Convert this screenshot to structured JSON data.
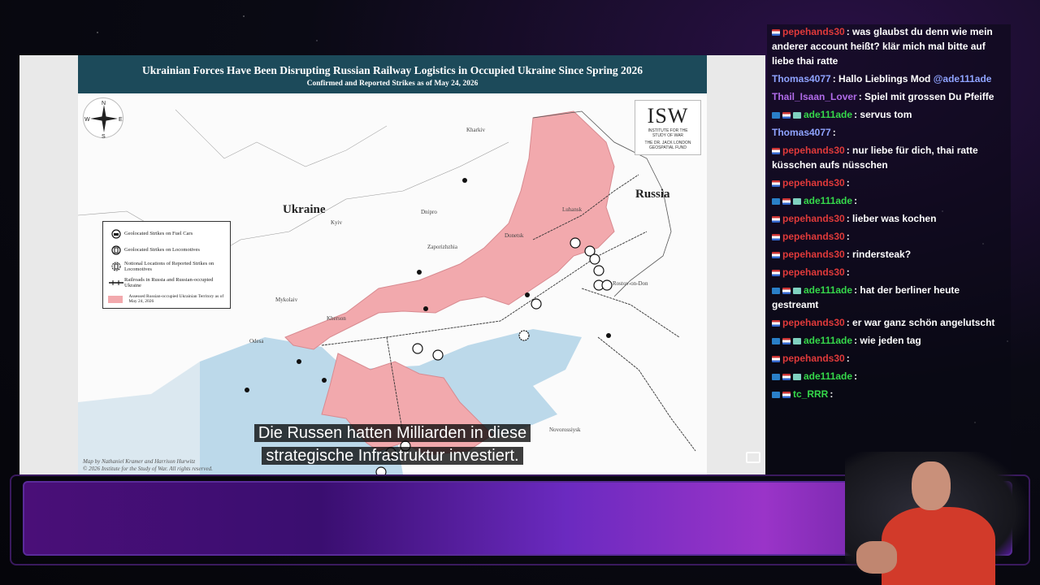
{
  "map": {
    "title": "Ukrainian Forces Have Been Disrupting Russian Railway Logistics in Occupied Ukraine Since Spring 2026",
    "subtitle": "Confirmed and Reported Strikes as of May 24, 2026",
    "compass": {
      "n": "N",
      "s": "S",
      "e": "E",
      "w": "W"
    },
    "logo": {
      "letters": "ISW",
      "org_line1": "INSTITUTE FOR THE",
      "org_line2": "STUDY OF WAR",
      "fund_line1": "THE DR. JACK LONDON",
      "fund_line2": "GEOSPATIAL FUND"
    },
    "countries": {
      "ukraine": "Ukraine",
      "russia": "Russia"
    },
    "cities": {
      "kharkiv": "Kharkiv",
      "kyiv": "Kyiv",
      "dnipro": "Dnipro",
      "zaporizhzhia": "Zaporizhzhia",
      "donetsk": "Donetsk",
      "luhansk": "Luhansk",
      "rostov": "Rostov-on-Don",
      "mykolaiv": "Mykolaiv",
      "kherson": "Kherson",
      "odesa": "Odesa",
      "novorossiysk": "Novorossiysk"
    },
    "legend": {
      "fuel_cars": "Geolocated Strikes on Fuel Cars",
      "locomotives": "Geolocated Strikes on Locomotives",
      "notional": "Notional Locations of Reported Strikes on Locomotives",
      "railroads": "Railroads in Russia and Russian-occupied Ukraine",
      "occupied": "Assessed Russian-occupied Ukrainian Territory as of May 24, 2026"
    },
    "credits": {
      "line1": "Map by Nathaniel Kramer and Harrison Hurwitz",
      "line2": "© 2026 Institute for the Study of War. All rights reserved."
    },
    "colors": {
      "occupied": "#f2a9ad",
      "sea": "#bcd9ea",
      "title_bar": "#1c4a5a"
    }
  },
  "caption": {
    "line1": "Die Russen hatten Milliarden in diese",
    "line2": "strategische Infrastruktur investiert."
  },
  "chat": [
    {
      "name": "pepehands30",
      "color": "#e03a3a",
      "badges": [
        "flag"
      ],
      "message": ": was glaubst du denn wie mein anderer account heißt? klär mich mal bitte auf liebe thai ratte"
    },
    {
      "name": "Thomas4077",
      "color": "#8fa3ff",
      "badges": [],
      "message": ": Hallo Lieblings Mod ",
      "mention": "@ade111ade"
    },
    {
      "name": "Thail_Isaan_Lover",
      "color": "#b06be8",
      "badges": [],
      "message": ": Spiel mit grossen Du Pfeiffe"
    },
    {
      "name": "ade111ade",
      "color": "#35d84a",
      "badges": [
        "vip",
        "flag",
        "sub"
      ],
      "message": ": servus tom"
    },
    {
      "name": "Thomas4077",
      "color": "#8fa3ff",
      "badges": [],
      "message": ":"
    },
    {
      "name": "pepehands30",
      "color": "#e03a3a",
      "badges": [
        "flag"
      ],
      "message": ": nur liebe für dich, thai ratte küsschen aufs nüsschen"
    },
    {
      "name": "pepehands30",
      "color": "#e03a3a",
      "badges": [
        "flag"
      ],
      "message": ":"
    },
    {
      "name": "ade111ade",
      "color": "#35d84a",
      "badges": [
        "vip",
        "flag",
        "sub"
      ],
      "message": ":"
    },
    {
      "name": "pepehands30",
      "color": "#e03a3a",
      "badges": [
        "flag"
      ],
      "message": ": lieber was kochen"
    },
    {
      "name": "pepehands30",
      "color": "#e03a3a",
      "badges": [
        "flag"
      ],
      "message": ":"
    },
    {
      "name": "pepehands30",
      "color": "#e03a3a",
      "badges": [
        "flag"
      ],
      "message": ": rindersteak?"
    },
    {
      "name": "pepehands30",
      "color": "#e03a3a",
      "badges": [
        "flag"
      ],
      "message": ":"
    },
    {
      "name": "ade111ade",
      "color": "#35d84a",
      "badges": [
        "vip",
        "flag",
        "sub"
      ],
      "message": ": hat der berliner heute gestreamt"
    },
    {
      "name": "pepehands30",
      "color": "#e03a3a",
      "badges": [
        "flag"
      ],
      "message": ": er war ganz schön angelutscht"
    },
    {
      "name": "ade111ade",
      "color": "#35d84a",
      "badges": [
        "vip",
        "flag",
        "sub"
      ],
      "message": ": wie jeden tag"
    },
    {
      "name": "pepehands30",
      "color": "#e03a3a",
      "badges": [
        "flag"
      ],
      "message": ":"
    },
    {
      "name": "ade111ade",
      "color": "#35d84a",
      "badges": [
        "vip",
        "flag",
        "sub"
      ],
      "message": ":"
    },
    {
      "name": "tc_RRR",
      "color": "#35d84a",
      "badges": [
        "vip",
        "flag"
      ],
      "message": ":"
    }
  ]
}
